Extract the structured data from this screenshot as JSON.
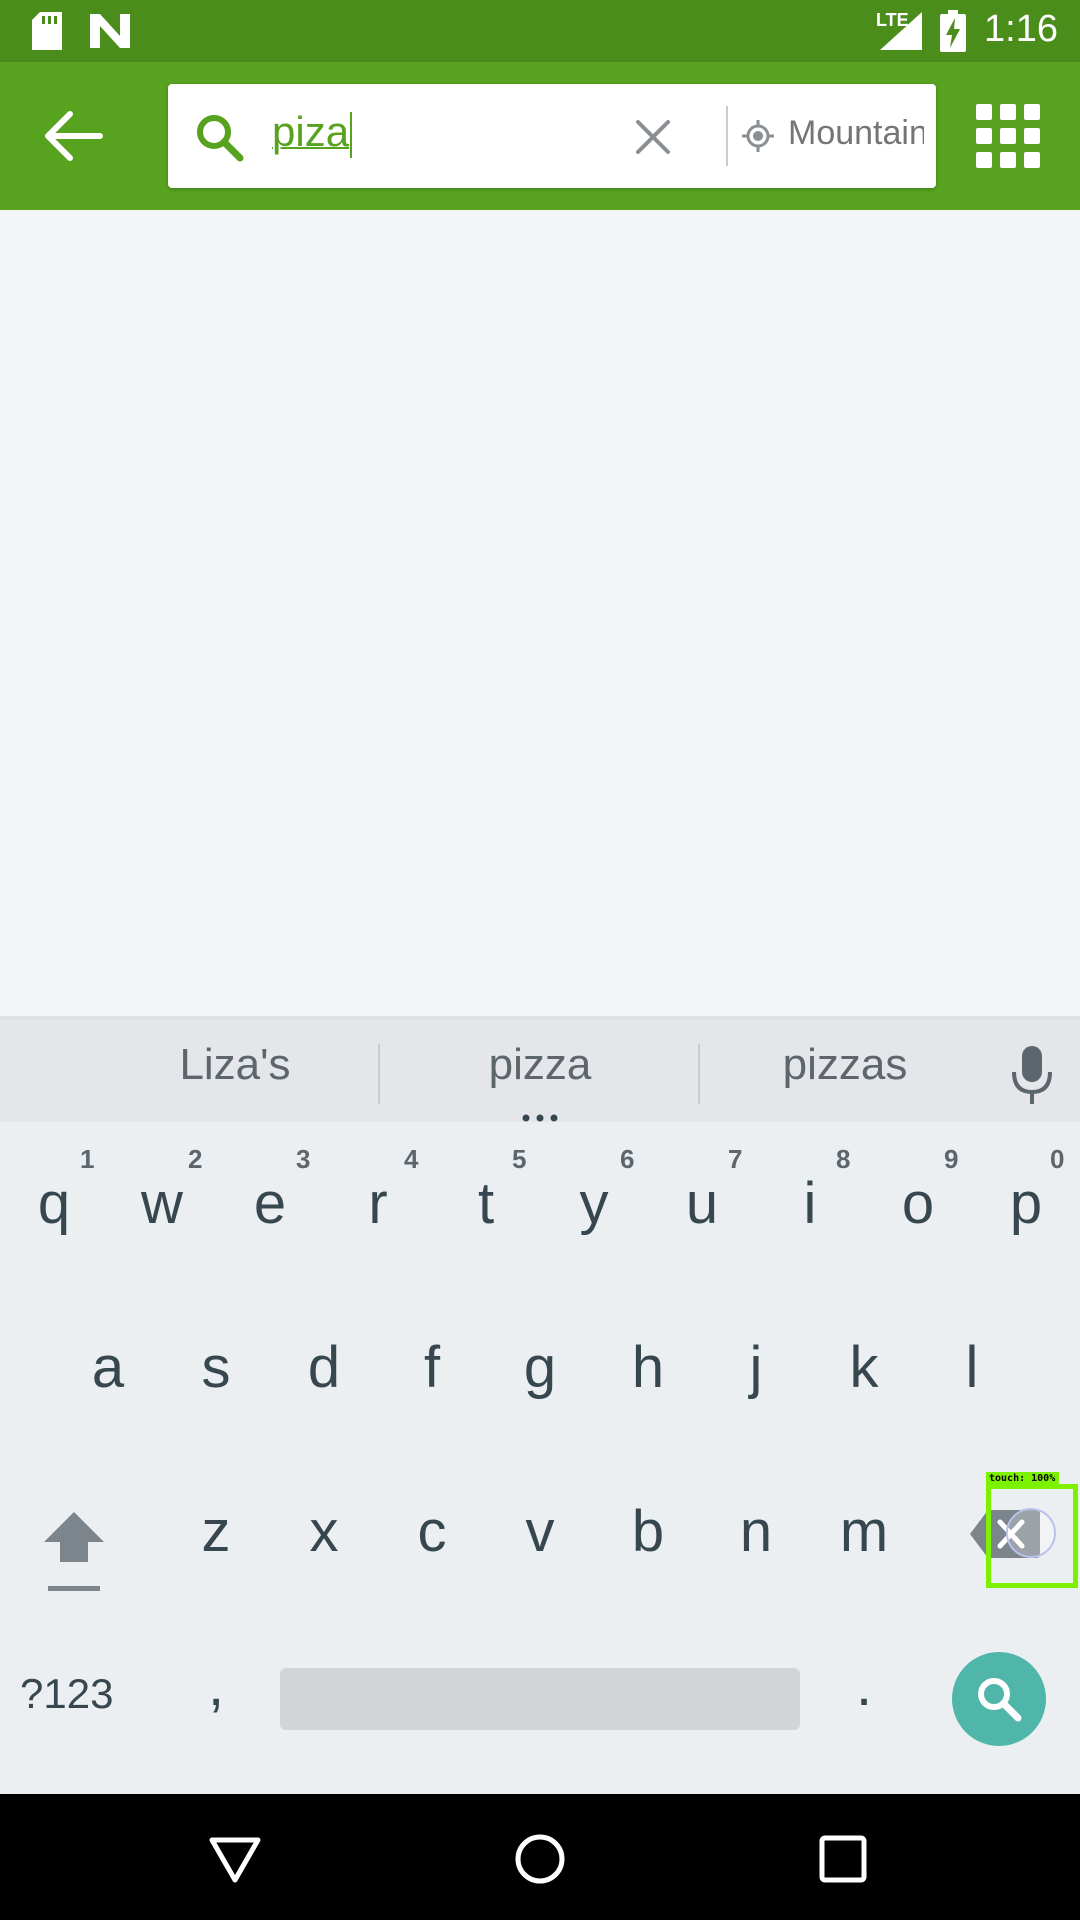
{
  "status_bar": {
    "time": "1:16",
    "network": "LTE",
    "icons": [
      "sd-card-icon",
      "n-notification-icon",
      "signal-icon",
      "battery-charging-icon"
    ]
  },
  "app_bar": {
    "search_query": "piza",
    "location_text": "Mountain",
    "icons": [
      "back-arrow-icon",
      "search-icon",
      "clear-icon",
      "location-icon",
      "grid-icon"
    ]
  },
  "keyboard": {
    "suggestions": [
      "Liza's",
      "pizza",
      "pizzas"
    ],
    "row1": [
      {
        "key": "q",
        "hint": "1"
      },
      {
        "key": "w",
        "hint": "2"
      },
      {
        "key": "e",
        "hint": "3"
      },
      {
        "key": "r",
        "hint": "4"
      },
      {
        "key": "t",
        "hint": "5"
      },
      {
        "key": "y",
        "hint": "6"
      },
      {
        "key": "u",
        "hint": "7"
      },
      {
        "key": "i",
        "hint": "8"
      },
      {
        "key": "o",
        "hint": "9"
      },
      {
        "key": "p",
        "hint": "0"
      }
    ],
    "row2": [
      "a",
      "s",
      "d",
      "f",
      "g",
      "h",
      "j",
      "k",
      "l"
    ],
    "row3": [
      "z",
      "x",
      "c",
      "v",
      "b",
      "n",
      "m"
    ],
    "row4": {
      "symbols": "?123",
      "comma": ",",
      "period": "."
    }
  },
  "touch_overlay": {
    "label": "touch: 100%"
  },
  "colors": {
    "accent": "#57a21f",
    "status_bar": "#4b8d1a",
    "search_key": "#4fb6a9",
    "touch": "#7df200"
  }
}
